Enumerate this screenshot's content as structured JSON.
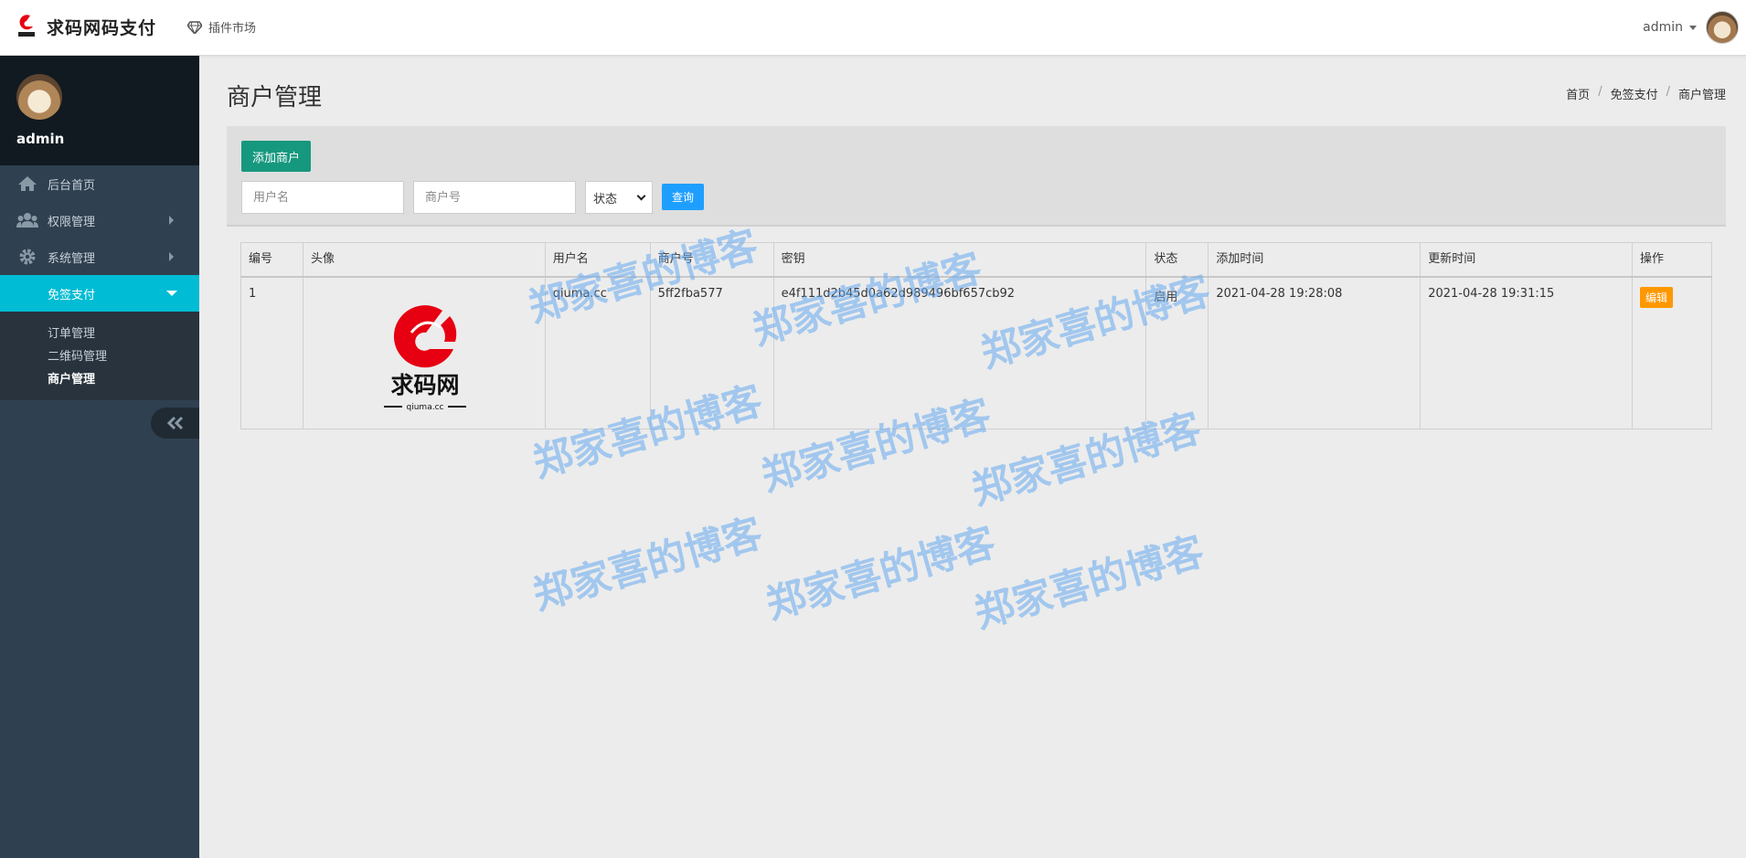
{
  "topbar": {
    "brand_title": "求码网码支付",
    "brand_logo_text": "求码网",
    "plugin_market_label": "插件市场",
    "user_name": "admin"
  },
  "sidebar": {
    "profile_name": "admin",
    "menu": [
      {
        "label": "后台首页",
        "icon": "home-icon"
      },
      {
        "label": "权限管理",
        "icon": "users-icon"
      },
      {
        "label": "系统管理",
        "icon": "gear-icon"
      },
      {
        "label": "免签支付",
        "icon": ""
      }
    ],
    "submenu": [
      {
        "label": "订单管理"
      },
      {
        "label": "二维码管理"
      },
      {
        "label": "商户管理"
      }
    ]
  },
  "page": {
    "title": "商户管理",
    "breadcrumb": [
      "首页",
      "免签支付",
      "商户管理"
    ]
  },
  "toolbar": {
    "add_label": "添加商户",
    "username_placeholder": "用户名",
    "merchant_placeholder": "商户号",
    "status_value": "状态",
    "query_label": "查询"
  },
  "table": {
    "columns": [
      "编号",
      "头像",
      "用户名",
      "商户号",
      "密钥",
      "状态",
      "添加时间",
      "更新时间",
      "操作"
    ],
    "rows": [
      {
        "id": "1",
        "avatar_text": "求码网",
        "avatar_sub": "qiuma.cc",
        "username": "qiuma.cc",
        "merchant_no": "5ff2fba577",
        "secret": "e4f111d2b45d0a62d989496bf657cb92",
        "status": "启用",
        "created": "2021-04-28 19:28:08",
        "updated": "2021-04-28 19:31:15",
        "action": "编辑"
      }
    ]
  },
  "watermark": {
    "text": "郑家喜的博客"
  },
  "colors": {
    "sidebar_bg": "#2f4050",
    "sidebar_active": "#00bcd4",
    "add_button": "#16987e",
    "query_button": "#1e9fff",
    "edit_button": "#ff9800",
    "logo_red": "#e60012"
  }
}
